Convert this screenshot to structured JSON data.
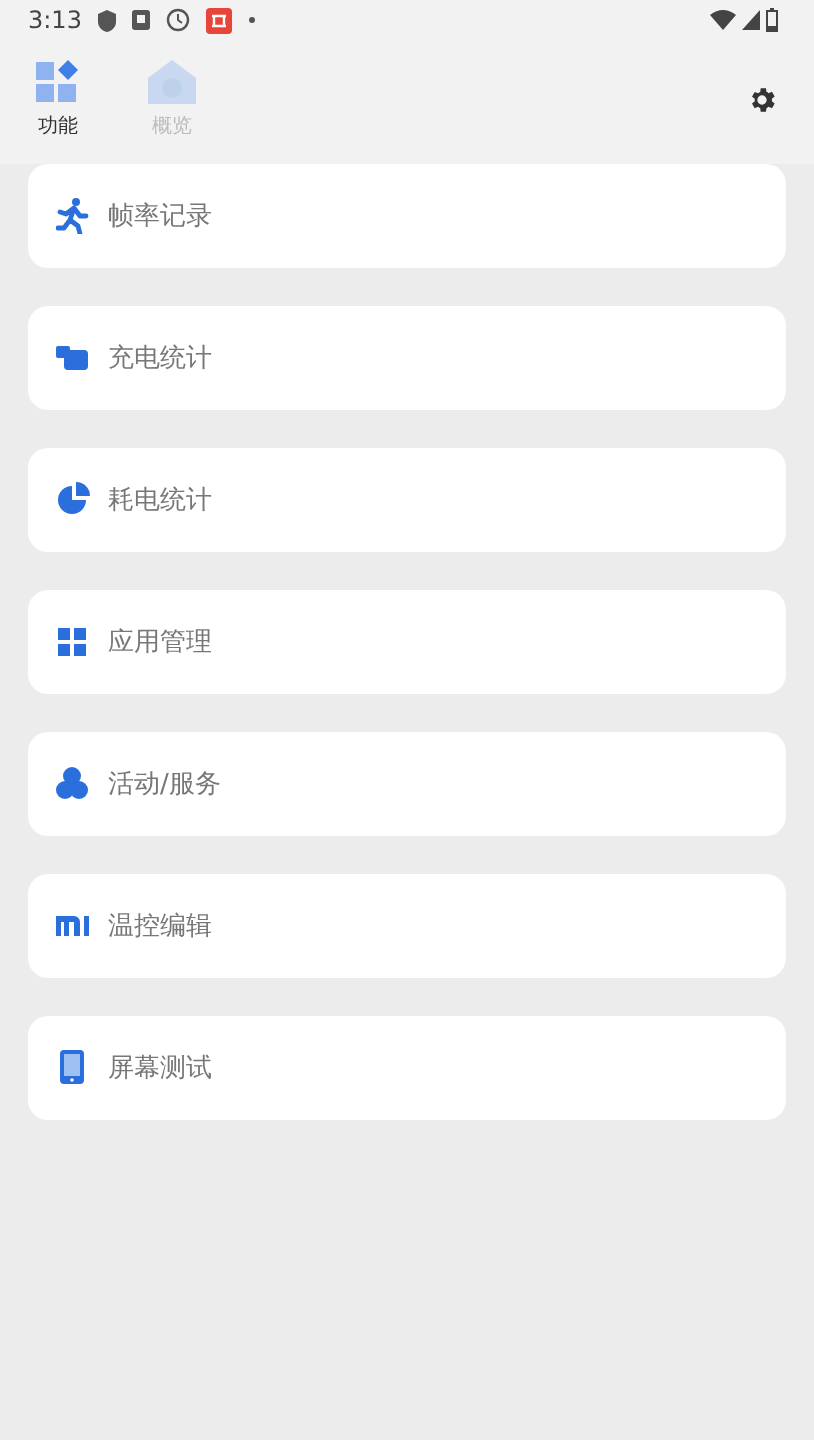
{
  "status_bar": {
    "time": "3:13"
  },
  "tabs": [
    {
      "label": "功能",
      "selected": true,
      "kind": "grid"
    },
    {
      "label": "概览",
      "selected": false,
      "kind": "home"
    }
  ],
  "items": [
    {
      "label": "帧率记录",
      "kind": "run"
    },
    {
      "label": "充电统计",
      "kind": "charge"
    },
    {
      "label": "耗电统计",
      "kind": "pie"
    },
    {
      "label": "应用管理",
      "kind": "apps"
    },
    {
      "label": "活动/服务",
      "kind": "cluster"
    },
    {
      "label": "温控编辑",
      "kind": "mi"
    },
    {
      "label": "屏幕测试",
      "kind": "phone"
    }
  ]
}
